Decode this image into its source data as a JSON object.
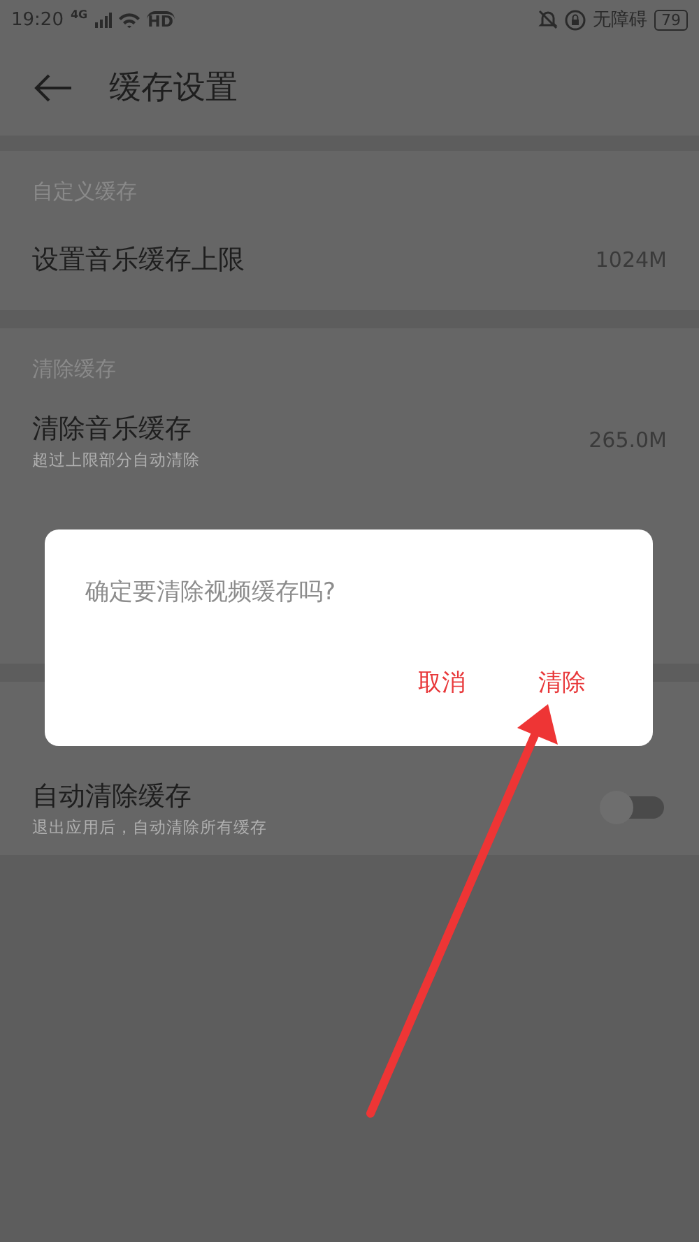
{
  "status_bar": {
    "time": "19:20",
    "network": "4G",
    "hd": "HD",
    "accessibility": "无障碍",
    "battery": "79"
  },
  "header": {
    "title": "缓存设置"
  },
  "sections": [
    {
      "header": "自定义缓存",
      "rows": [
        {
          "kind": "value",
          "title": "设置音乐缓存上限",
          "value": "1024M"
        }
      ]
    },
    {
      "header": "清除缓存",
      "rows": [
        {
          "kind": "value",
          "title": "清除音乐缓存",
          "subtitle": "超过上限部分自动清除",
          "value": "265.0M"
        }
      ]
    },
    {
      "rows": [
        {
          "kind": "toggle",
          "title": "自动清除缓存",
          "subtitle": "退出应用后，自动清除所有缓存",
          "on": false
        }
      ]
    }
  ],
  "dialog": {
    "message": "确定要清除视频缓存吗?",
    "buttons": [
      "取消",
      "清除"
    ]
  }
}
